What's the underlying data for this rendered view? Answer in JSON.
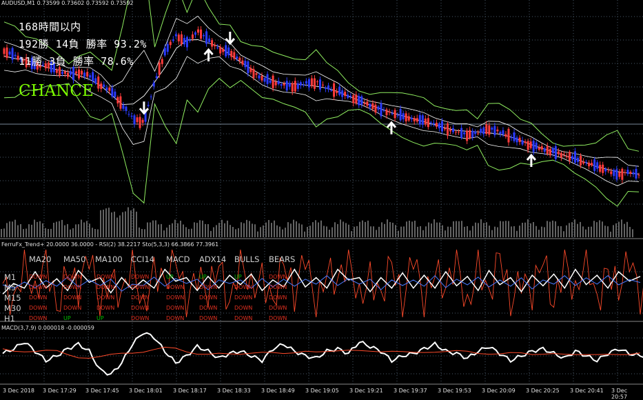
{
  "header": {
    "symbol": "AUDUSD,M1  0.73599 0.73602 0.73592 0.73592"
  },
  "stats_panel": {
    "line1": "168時間以内",
    "line2": "192勝 14負  勝率 93.2%",
    "line3": " 11勝  3負  勝率 78.6%",
    "chance": "CHANCE"
  },
  "indicator_header": "FerruFx_Trend+ 20.0000 36.0000 - RSI(2) 38.2217 Sto(5,3,3) 66.3866 77.3961",
  "trend_table": {
    "columns": [
      "MA20",
      "MA50",
      "MA100",
      "CCI14",
      "MACD",
      "ADX14",
      "BULLS",
      "BEARS"
    ],
    "rows": [
      {
        "label": "M1",
        "cells": [
          "DOWN",
          "DOWN",
          "DOWN",
          "DOWN",
          "UP",
          "UP",
          "UP",
          "DOWN"
        ]
      },
      {
        "label": "M5",
        "cells": [
          "DOWN",
          "DOWN",
          "DOWN",
          "DOWN",
          "DOWN",
          "DOWN",
          "DOWN",
          "DOWN"
        ]
      },
      {
        "label": "M15",
        "cells": [
          "DOWN",
          "DOWN",
          "DOWN",
          "DOWN",
          "DOWN",
          "DOWN",
          "DOWN",
          "DOWN"
        ]
      },
      {
        "label": "M30",
        "cells": [
          "DOWN",
          "DOWN",
          "DOWN",
          "DOWN",
          "DOWN",
          "DOWN",
          "DOWN",
          "DOWN"
        ]
      },
      {
        "label": "H1",
        "cells": [
          "DOWN",
          "UP",
          "UP",
          "DOWN",
          "DOWN",
          "DOWN",
          "DOWN",
          "DOWN"
        ]
      }
    ],
    "up_color": "#00c000",
    "down_color": "#e03020"
  },
  "macd_header": "MACD(3,7,9) 0.000018 -0.000059",
  "time_axis": [
    "3 Dec 2018",
    "3 Dec 17:29",
    "3 Dec 17:45",
    "3 Dec 18:01",
    "3 Dec 18:17",
    "3 Dec 18:33",
    "3 Dec 18:49",
    "3 Dec 19:05",
    "3 Dec 19:21",
    "3 Dec 19:37",
    "3 Dec 19:53",
    "3 Dec 20:09",
    "3 Dec 20:25",
    "3 Dec 20:41",
    "3 Dec 20:57"
  ],
  "colors": {
    "background": "#000000",
    "bull_candle": "#ff3b3b",
    "bear_candle": "#2a3bff",
    "bands": "#90ee60",
    "ma": "#ffffff",
    "grid": "#4a5a6a",
    "rsi": "#ff4a2a",
    "stoch_main": "#ffffff",
    "stoch_signal": "#4a7bff",
    "macd_signal": "#ff4a2a",
    "macd_main": "#ffffff"
  },
  "chart_data": {
    "type": "line",
    "symbol": "AUDUSD",
    "timeframe": "M1",
    "ohlc_header": {
      "open": 0.73599,
      "high": 0.73602,
      "low": 0.73592,
      "close": 0.73592
    },
    "x_ticks": [
      "3 Dec 2018",
      "3 Dec 17:29",
      "3 Dec 17:45",
      "3 Dec 18:01",
      "3 Dec 18:17",
      "3 Dec 18:33",
      "3 Dec 18:49",
      "3 Dec 19:05",
      "3 Dec 19:21",
      "3 Dec 19:37",
      "3 Dec 19:53",
      "3 Dec 20:09",
      "3 Dec 20:25",
      "3 Dec 20:41",
      "3 Dec 20:57"
    ],
    "price_path": [
      0.6,
      0.66,
      0.74,
      0.8,
      0.78,
      0.86,
      0.9,
      0.88,
      0.92,
      1.04,
      1.12,
      1.3,
      1.48,
      1.52,
      1.0,
      0.6,
      0.4,
      0.5,
      0.34,
      0.46,
      0.58,
      0.62,
      0.72,
      0.86,
      0.96,
      1.0,
      1.04,
      1.06,
      1.02,
      1.0,
      1.08,
      1.12,
      1.18,
      1.24,
      1.3,
      1.36,
      1.4,
      1.44,
      1.48,
      1.5,
      1.54,
      1.6,
      1.64,
      1.68,
      1.66,
      1.6,
      1.64,
      1.7,
      1.76,
      1.82,
      1.86,
      1.9,
      1.94,
      1.98,
      2.04,
      2.08,
      2.14,
      2.2,
      2.16,
      2.2
    ],
    "arrows": [
      {
        "dir": "down",
        "i": 13
      },
      {
        "dir": "down",
        "i": 21
      },
      {
        "dir": "up",
        "i": 19
      },
      {
        "dir": "up",
        "i": 36
      },
      {
        "dir": "up",
        "i": 49
      }
    ],
    "rsi_series": [
      0.5,
      0.2,
      0.8,
      0.3,
      0.9,
      0.1,
      0.7,
      0.4,
      0.95,
      0.2,
      0.6,
      0.3,
      0.85,
      0.1,
      0.7,
      0.5,
      0.9,
      0.2,
      0.65,
      0.35,
      0.8,
      0.15,
      0.9,
      0.4,
      0.6,
      0.2,
      0.85,
      0.3,
      0.95,
      0.1,
      0.7,
      0.5,
      0.9,
      0.25,
      0.6,
      0.3,
      0.85,
      0.15,
      0.95,
      0.2,
      0.7,
      0.4,
      0.9,
      0.1,
      0.8,
      0.3,
      0.95,
      0.2,
      0.6,
      0.35,
      0.9,
      0.15,
      0.85,
      0.3,
      0.95,
      0.2,
      0.7,
      0.4,
      0.9,
      0.3
    ],
    "macd_series": [
      0.1,
      0.3,
      0.6,
      0.2,
      -0.2,
      0.0,
      0.3,
      0.5,
      0.2,
      -0.6,
      -0.8,
      -0.3,
      0.5,
      1.0,
      0.8,
      0.2,
      -0.3,
      0.0,
      0.4,
      0.2,
      -0.1,
      0.1,
      0.2,
      0.0,
      -0.2,
      0.3,
      0.5,
      0.2,
      0.0,
      -0.1,
      0.2,
      0.3,
      0.1,
      0.6,
      0.4,
      0.2,
      -0.2,
      0.0,
      0.1,
      0.3,
      0.5,
      0.2,
      0.1,
      -0.1,
      0.2,
      0.4,
      0.1,
      -0.2,
      0.0,
      0.2,
      0.3,
      0.1,
      -0.1,
      0.2,
      0.0,
      -0.2,
      0.1,
      0.3,
      0.1,
      0.0
    ],
    "grid": true
  }
}
